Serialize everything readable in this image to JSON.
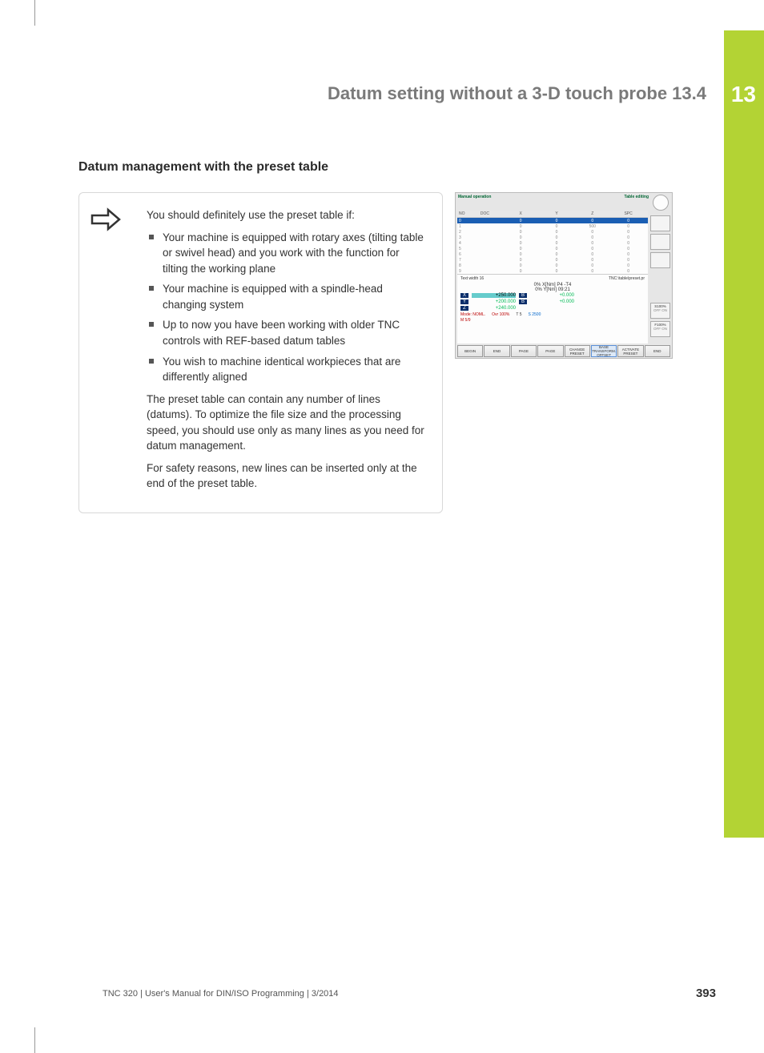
{
  "chapter_number": "13",
  "section_header": "Datum setting without a 3-D touch probe   13.4",
  "subheading": "Datum management with the preset table",
  "info": {
    "intro": "You should definitely use the preset table if:",
    "bullets": [
      "Your machine is equipped with rotary axes (tilting table or swivel head) and you work with the function for tilting the working plane",
      "Your machine is equipped with a spindle-head changing system",
      "Up to now you have been working with older TNC controls with REF-based datum tables",
      "You wish to machine identical workpieces that are differently aligned"
    ],
    "para1": "The preset table can contain any number of lines (datums). To optimize the file size and the processing speed, you should use only as many lines as you need for datum management.",
    "para2": "For safety reasons, new lines can be inserted only at the end of the preset table."
  },
  "screenshot": {
    "top_left": "Manual operation",
    "top_right": "Table editing",
    "columns": [
      "NO",
      "DOC",
      "X",
      "Y",
      "Z",
      "SPC"
    ],
    "rows": [
      {
        "no": "0",
        "doc": "",
        "x": "0",
        "y": "0",
        "z": "0",
        "spc": "0",
        "active": true
      },
      {
        "no": "1",
        "doc": "",
        "x": "0",
        "y": "0",
        "z": "500",
        "spc": "0"
      },
      {
        "no": "2",
        "doc": "",
        "x": "0",
        "y": "0",
        "z": "0",
        "spc": "0"
      },
      {
        "no": "3",
        "doc": "",
        "x": "0",
        "y": "0",
        "z": "0",
        "spc": "0"
      },
      {
        "no": "4",
        "doc": "",
        "x": "0",
        "y": "0",
        "z": "0",
        "spc": "0"
      },
      {
        "no": "5",
        "doc": "",
        "x": "0",
        "y": "0",
        "z": "0",
        "spc": "0"
      },
      {
        "no": "6",
        "doc": "",
        "x": "0",
        "y": "0",
        "z": "0",
        "spc": "0"
      },
      {
        "no": "7",
        "doc": "",
        "x": "0",
        "y": "0",
        "z": "0",
        "spc": "0"
      },
      {
        "no": "8",
        "doc": "",
        "x": "0",
        "y": "0",
        "z": "0",
        "spc": "0"
      },
      {
        "no": "9",
        "doc": "",
        "x": "0",
        "y": "0",
        "z": "0",
        "spc": "0"
      }
    ],
    "doc_left": "Text width 16",
    "doc_right": "TNC:\\table\\preset.pr",
    "dro1": "0% X[Nm] P4  -T4",
    "dro2": "0% Y[Nm]  09:21",
    "axes": [
      {
        "label": "X",
        "v1": "+250.000",
        "v2": "+0.000",
        "hl": true
      },
      {
        "label": "Y",
        "v1": "+200.000",
        "v2": "+0.000"
      },
      {
        "label": "Z",
        "v1": "+240.000",
        "v2": ""
      }
    ],
    "status_mode": "Mode: NOML.",
    "status_ovr": "Ovr 100%",
    "status_t": "T 5",
    "status_s": "S 2500",
    "status_m": "M 5/9",
    "softkeys": [
      "BEGIN",
      "END",
      "PAGE",
      "PAGE",
      "CHANGE PRESET",
      "BASE TRANSFORM. OFFSET",
      "ACTIVATE PRESET",
      "END"
    ],
    "right_small": {
      "s100": "S100%",
      "f100": "F100%",
      "off": "OFF",
      "on": "ON"
    }
  },
  "footer": "TNC 320 | User's Manual for DIN/ISO Programming | 3/2014",
  "page_number": "393"
}
